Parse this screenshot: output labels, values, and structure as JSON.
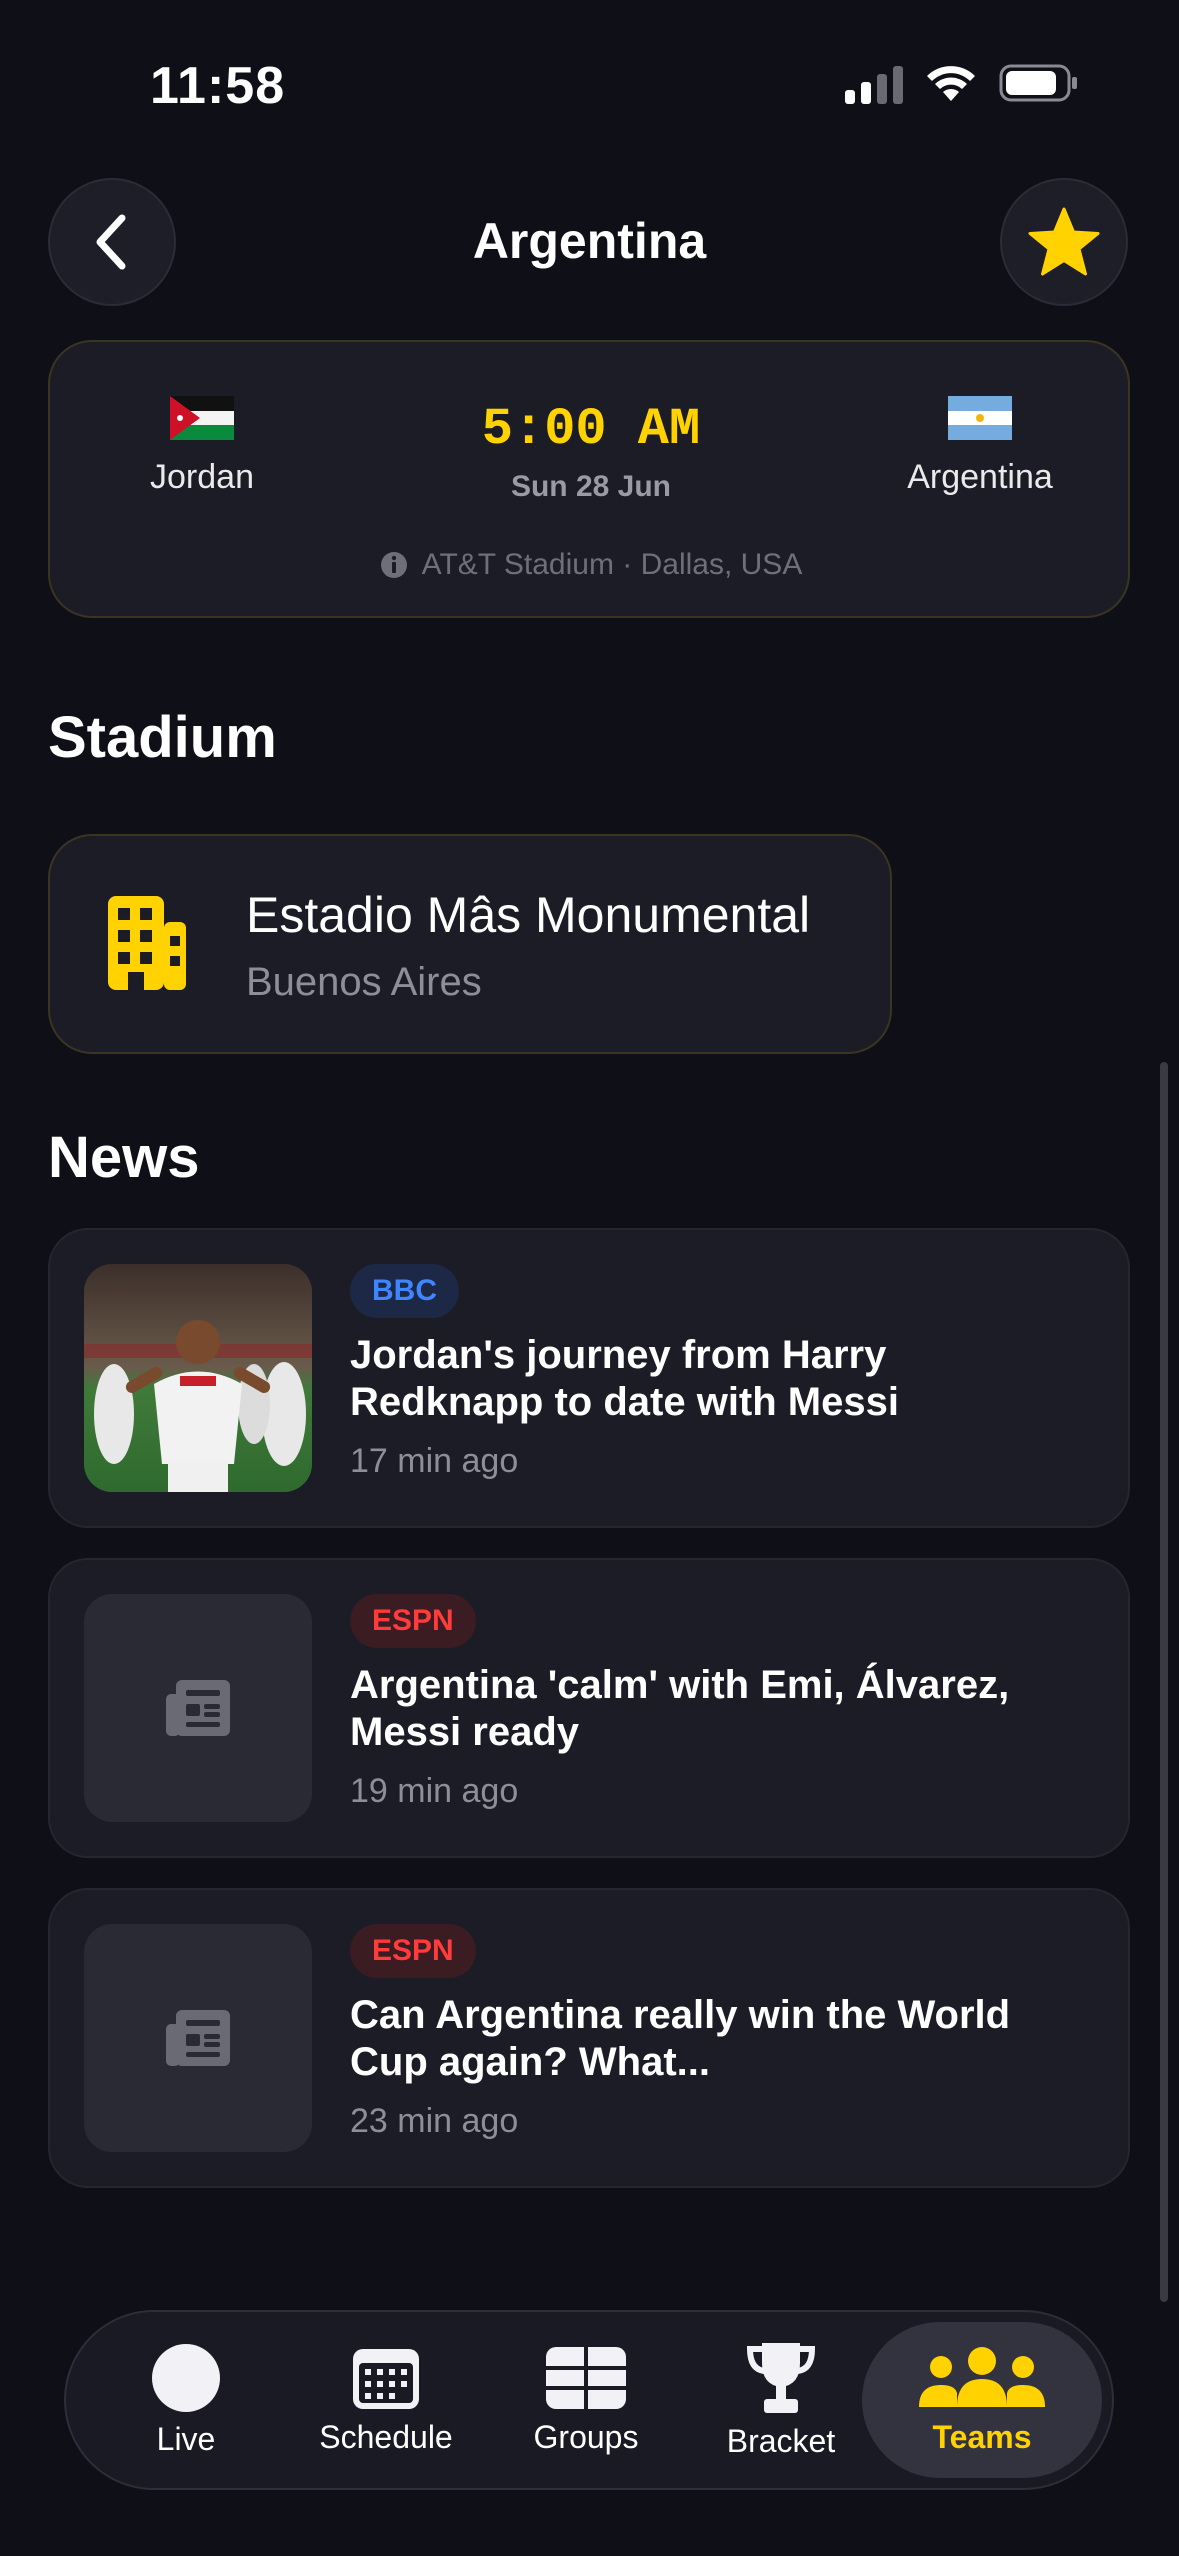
{
  "status_bar": {
    "time": "11:58"
  },
  "header": {
    "title": "Argentina",
    "back_icon": "chevron-left-icon",
    "favorite_icon": "star-icon"
  },
  "match": {
    "home_team": "Jordan",
    "away_team": "Argentina",
    "time": "5:00 AM",
    "date": "Sun 28 Jun",
    "venue": "AT&T Stadium · Dallas, USA"
  },
  "stadium_section": {
    "title": "Stadium",
    "name": "Estadio Mâs Monumental",
    "city": "Buenos Aires",
    "icon": "building-icon"
  },
  "news_section": {
    "title": "News",
    "items": [
      {
        "source": "BBC",
        "title": "Jordan's journey from Harry Redknapp to date with Messi",
        "time": "17 min ago"
      },
      {
        "source": "ESPN",
        "title": "Argentina 'calm' with Emi, Álvarez, Messi ready",
        "time": "19 min ago"
      },
      {
        "source": "ESPN",
        "title": "Can Argentina really win the World Cup again? What...",
        "time": "23 min ago"
      }
    ]
  },
  "tab_bar": {
    "items": [
      {
        "label": "Live",
        "icon": "live-dot-icon"
      },
      {
        "label": "Schedule",
        "icon": "calendar-icon"
      },
      {
        "label": "Groups",
        "icon": "grid-icon"
      },
      {
        "label": "Bracket",
        "icon": "trophy-icon"
      },
      {
        "label": "Teams",
        "icon": "people-icon"
      }
    ],
    "active": "Teams"
  },
  "colors": {
    "background": "#0f0f17",
    "card": "#1c1c26",
    "accent": "#ffd200",
    "bbc": "#3d86ff",
    "espn": "#ff3b3b"
  }
}
